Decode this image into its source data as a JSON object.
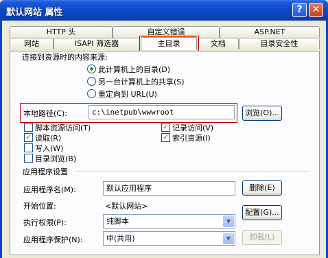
{
  "window": {
    "title": "默认网站 属性"
  },
  "tabs": {
    "row1": [
      "HTTP 头",
      "自定义错误",
      "ASP.NET"
    ],
    "row2": [
      "网站",
      "ISAPI 筛选器",
      "主目录",
      "文档",
      "目录安全性"
    ]
  },
  "source": {
    "label": "连接到资源时的内容来源:",
    "options": [
      "此计算机上的目录(D)",
      "另一台计算机上的共享(S)",
      "重定向到 URL(U)"
    ],
    "selected_index": 0
  },
  "path": {
    "label": "本地路径(C):",
    "value": "c:\\inetpub\\wwwroot",
    "browse_label": "浏览(O)..."
  },
  "permissions": {
    "left": [
      {
        "label": "脚本资源访问(T)",
        "checked": false
      },
      {
        "label": "读取(R)",
        "checked": true
      },
      {
        "label": "写入(W)",
        "checked": false
      },
      {
        "label": "目录浏览(B)",
        "checked": false
      }
    ],
    "right": [
      {
        "label": "记录访问(V)",
        "checked": true
      },
      {
        "label": "索引资源(I)",
        "checked": true
      }
    ]
  },
  "app": {
    "section_label": "应用程序设置",
    "name_label": "应用程序名(M):",
    "name_value": "默认应用程序",
    "remove_label": "删除(E)",
    "start_label": "开始位置:",
    "start_value": "<默认网站>",
    "config_label": "配置(G)...",
    "exec_label": "执行权限(P):",
    "exec_value": "纯脚本",
    "protect_label": "应用程序保护(N):",
    "protect_value": "中(共用)",
    "unload_label": "卸载(L)"
  },
  "colors": {
    "titlebar": "#0a47c8",
    "tab_highlight": "#e68b2c",
    "annotation_box": "#c00000"
  }
}
